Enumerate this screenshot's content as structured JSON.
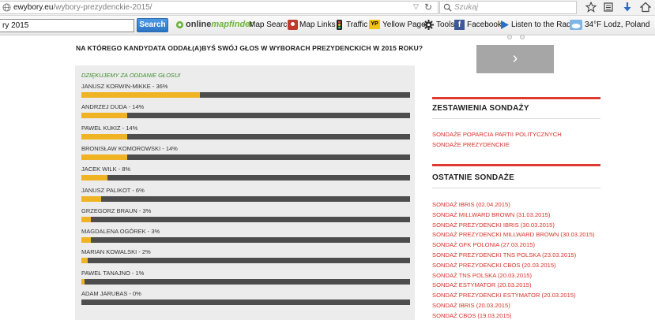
{
  "browser": {
    "url_host": "ewybory.eu",
    "url_path": "/wybory-prezydenckie-2015/",
    "search_placeholder": "Szukaj"
  },
  "toolbar": {
    "input_value": "ry 2015",
    "search_label": "Search",
    "brand_part1": "online",
    "brand_part2": "mapfinder",
    "items": {
      "map_search": "Map Search",
      "map_links": "Map Links",
      "traffic": "Traffic",
      "yellow_pages": "Yellow Pages",
      "tools": "Tools",
      "facebook": "Facebook",
      "radio": "Listen to the Radio",
      "weather": "34°F Lodz, Poland"
    },
    "yp_badge": "YP"
  },
  "poll": {
    "question": "NA KTÓREGO KANDYDATA ODDAŁ(A)BYŚ SWÓJ GŁOS W WYBORACH PREZYDENCKICH W 2015 ROKU?",
    "thanks": "DZIĘKUJEMY ZA ODDANIE GŁOSU!",
    "results": [
      {
        "label": "JANUSZ KORWIN-MIKKE - 36%",
        "percent": 36
      },
      {
        "label": "ANDRZEJ DUDA - 14%",
        "percent": 14
      },
      {
        "label": "PAWEŁ KUKIZ - 14%",
        "percent": 14
      },
      {
        "label": "BRONISŁAW KOMOROWSKI - 14%",
        "percent": 14
      },
      {
        "label": "JACEK WILK - 8%",
        "percent": 8
      },
      {
        "label": "JANUSZ PALIKOT - 6%",
        "percent": 6
      },
      {
        "label": "GRZEGORZ BRAUN - 3%",
        "percent": 3
      },
      {
        "label": "MAGDALENA OGÓREK - 3%",
        "percent": 3
      },
      {
        "label": "MARIAN KOWALSKI - 2%",
        "percent": 2
      },
      {
        "label": "PAWEŁ TANAJNO - 1%",
        "percent": 1
      },
      {
        "label": "ADAM JARUBAS - 0%",
        "percent": 0
      }
    ]
  },
  "sidebar": {
    "next_arrow": "›",
    "summaries_title": "ZESTAWIENIA SONDAŻY",
    "summaries_links": [
      "SONDAŻE POPARCIA PARTII POLITYCZNYCH",
      "SONDAŻE PREZYDENCKIE"
    ],
    "recent_title": "OSTATNIE SONDAŻE",
    "recent_links": [
      "SONDAŻ IBRIS (02.04.2015)",
      "SONDAŻ MILLWARD BROWN (31.03.2015)",
      "SONDAŻ PREZYDENCKI IBRIS (30.03.2015)",
      "SONDAŻ PREZYDENCKI MILLWARD BROWN (30.03.2015)",
      "SONDAŻ GFK POLONIA (27.03.2015)",
      "SONDAŻ PREZYDENCKI TNS POLSKA (23.03.2015)",
      "SONDAŻ PREZYDENCKI CBOS (20.03.2015)",
      "SONDAŻ TNS POLSKA (20.03.2015)",
      "SONDAŻ ESTYMATOR (20.03.2015)",
      "SONDAŻ PREZYDENCKI ESTYMATOR (20.03.2015)",
      "SONDAŻ IBRIS (20.03.2015)",
      "SONDAŻ CBOS (19.03.2015)"
    ]
  },
  "colors": {
    "accent_red": "#e03a2f",
    "bar_fill": "#f0b323",
    "bar_track": "#4d4d4d",
    "link": "#d6332a"
  }
}
